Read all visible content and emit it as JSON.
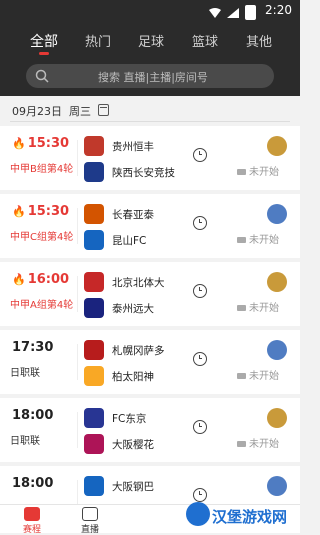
{
  "status": {
    "time": "2:20"
  },
  "tabs": [
    {
      "label": "全部",
      "active": true
    },
    {
      "label": "热门"
    },
    {
      "label": "足球"
    },
    {
      "label": "篮球"
    },
    {
      "label": "其他"
    }
  ],
  "search": {
    "placeholder": "搜索 直播|主播|房间号"
  },
  "date": {
    "label": "09月23日",
    "weekday": "周三"
  },
  "colors": {
    "accent": "#e53935",
    "header_bg": "#2b2b2b",
    "muted": "#999999"
  },
  "matches": [
    {
      "time": "15:30",
      "hot": true,
      "league": "中甲B组第4轮",
      "home": "贵州恒丰",
      "away": "陕西长安竞技",
      "status": "未开始",
      "home_color": "#c0392b",
      "away_color": "#1e3a8a"
    },
    {
      "time": "15:30",
      "hot": true,
      "league": "中甲C组第4轮",
      "home": "长春亚泰",
      "away": "昆山FC",
      "status": "未开始",
      "home_color": "#d35400",
      "away_color": "#1565c0"
    },
    {
      "time": "16:00",
      "hot": true,
      "league": "中甲A组第4轮",
      "home": "北京北体大",
      "away": "泰州远大",
      "status": "未开始",
      "home_color": "#c62828",
      "away_color": "#1a237e"
    },
    {
      "time": "17:30",
      "hot": false,
      "league": "日职联",
      "home": "札幌冈萨多",
      "away": "柏太阳神",
      "status": "未开始",
      "home_color": "#b71c1c",
      "away_color": "#f9a825"
    },
    {
      "time": "18:00",
      "hot": false,
      "league": "日职联",
      "home": "FC东京",
      "away": "大阪樱花",
      "status": "未开始",
      "home_color": "#283593",
      "away_color": "#ad1457"
    },
    {
      "time": "18:00",
      "hot": false,
      "league": "",
      "home": "大阪钢巴",
      "away": "",
      "status": "",
      "home_color": "#1565c0",
      "away_color": "#999999"
    }
  ],
  "bottom_nav": [
    {
      "label": "赛程",
      "active": true
    },
    {
      "label": "直播"
    }
  ],
  "watermark": {
    "text": "汉堡游戏网"
  }
}
